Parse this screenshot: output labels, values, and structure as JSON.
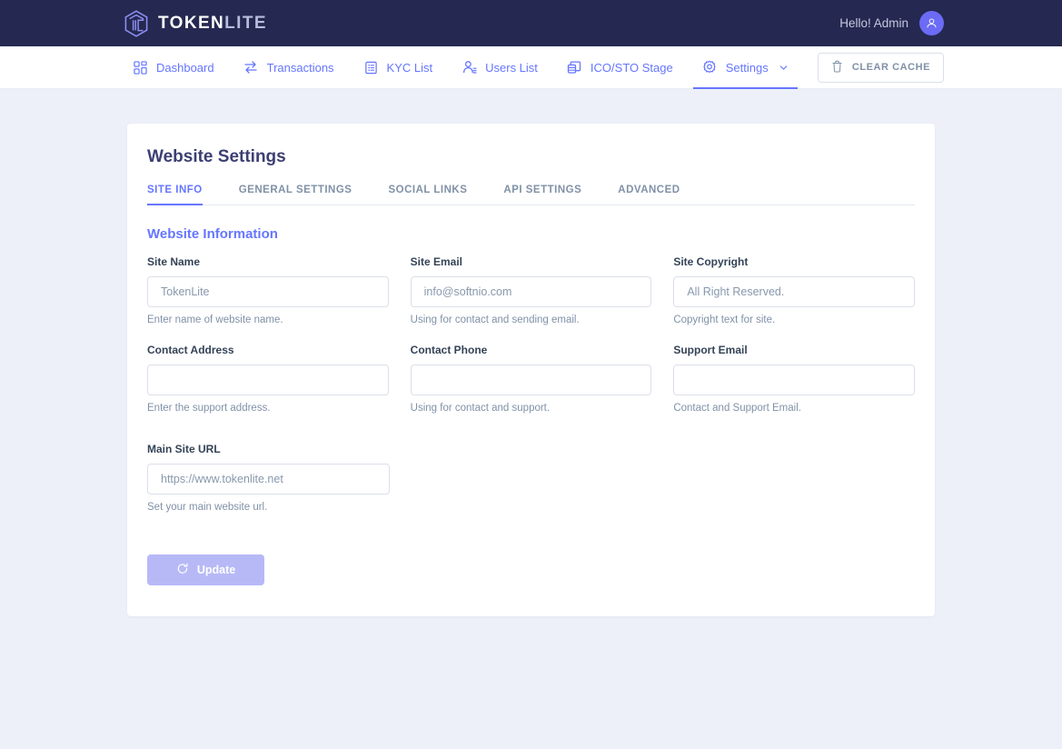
{
  "header": {
    "brand_primary": "TOKEN",
    "brand_secondary": "LITE",
    "greeting": "Hello! Admin",
    "logo_icon": "hexagon-tl-logo-icon",
    "avatar_icon": "user-avatar-icon",
    "bg_color": "#252850"
  },
  "nav": {
    "items": [
      {
        "label": "Dashboard",
        "icon": "grid-icon",
        "active": false
      },
      {
        "label": "Transactions",
        "icon": "swap-arrows-icon",
        "active": false
      },
      {
        "label": "KYC List",
        "icon": "form-list-icon",
        "active": false
      },
      {
        "label": "Users List",
        "icon": "user-check-icon",
        "active": false
      },
      {
        "label": "ICO/STO Stage",
        "icon": "coins-stack-icon",
        "active": false
      },
      {
        "label": "Settings",
        "icon": "gear-icon",
        "active": true,
        "has_chevron": true
      }
    ],
    "clear_cache_label": "CLEAR CACHE",
    "clear_cache_icon": "trash-icon",
    "accent_color": "#6576ff"
  },
  "card": {
    "title": "Website Settings",
    "tabs": [
      {
        "label": "SITE INFO",
        "active": true
      },
      {
        "label": "GENERAL SETTINGS",
        "active": false
      },
      {
        "label": "SOCIAL LINKS",
        "active": false
      },
      {
        "label": "API SETTINGS",
        "active": false
      },
      {
        "label": "ADVANCED",
        "active": false
      }
    ],
    "section_title": "Website Information",
    "fields": {
      "site_name": {
        "label": "Site Name",
        "value": "",
        "placeholder": "TokenLite",
        "note": "Enter name of website name."
      },
      "site_email": {
        "label": "Site Email",
        "value": "",
        "placeholder": "info@softnio.com",
        "note": "Using for contact and sending email."
      },
      "site_copyright": {
        "label": "Site Copyright",
        "value": "",
        "placeholder": "All Right Reserved.",
        "note": "Copyright text for site."
      },
      "contact_address": {
        "label": "Contact Address",
        "value": "",
        "placeholder": "",
        "note": "Enter the support address."
      },
      "contact_phone": {
        "label": "Contact Phone",
        "value": "",
        "placeholder": "",
        "note": "Using for contact and support."
      },
      "support_email": {
        "label": "Support Email",
        "value": "",
        "placeholder": "",
        "note": "Contact and Support Email."
      },
      "main_site_url": {
        "label": "Main Site URL",
        "value": "",
        "placeholder": "https://www.tokenlite.net",
        "note": "Set your main website url."
      }
    },
    "update_button": {
      "label": "Update",
      "icon": "refresh-sync-icon",
      "color": "#b7b9f7"
    }
  }
}
